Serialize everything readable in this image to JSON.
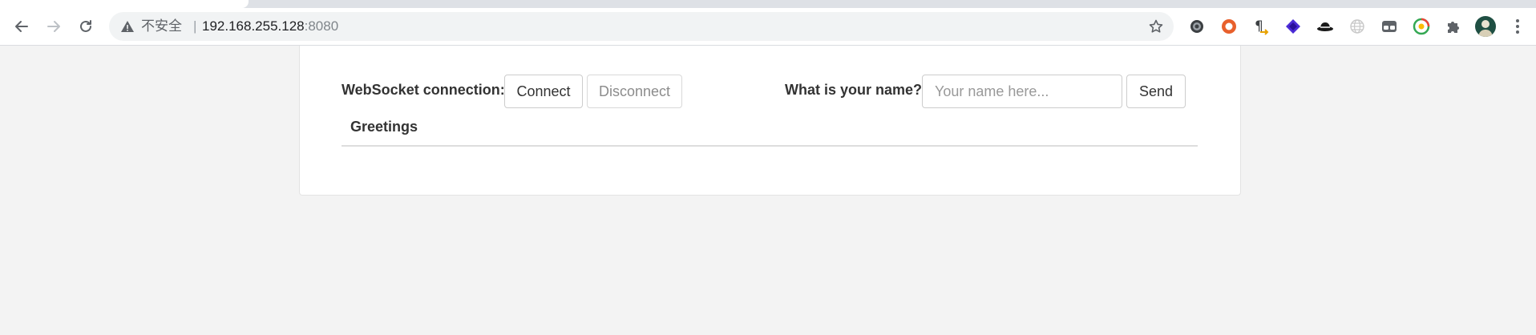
{
  "browser": {
    "security_label": "不安全",
    "separator": "|",
    "url_host": "192.168.255.128",
    "url_port": ":8080",
    "icons": {
      "back": "arrow-left-icon",
      "forward": "arrow-right-icon",
      "reload": "reload-icon",
      "warning": "warning-triangle-icon",
      "bookmark": "star-icon",
      "menu": "vertical-dots-icon"
    },
    "extensions": [
      "gear-extension-icon",
      "orange-ring-extension-icon",
      "pilcrow-extension-icon",
      "purple-layers-extension-icon",
      "hat-extension-icon",
      "globe-extension-icon",
      "glasses-extension-icon",
      "sync-extension-icon",
      "puzzle-icon"
    ]
  },
  "page": {
    "ws_label": "WebSocket connection:",
    "connect_label": "Connect",
    "disconnect_label": "Disconnect",
    "name_label": "What is your name?",
    "name_placeholder": "Your name here...",
    "name_value": "",
    "send_label": "Send",
    "greetings_header": "Greetings",
    "disconnect_disabled": true
  }
}
